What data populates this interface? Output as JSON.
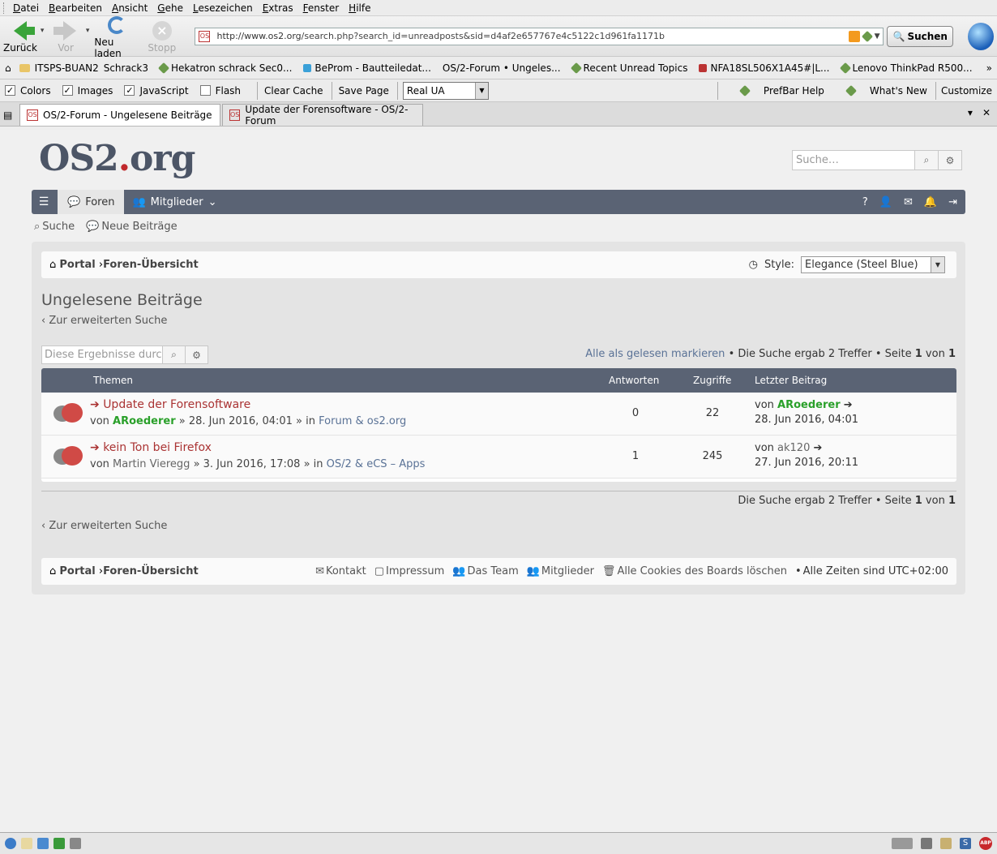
{
  "menu": [
    "Datei",
    "Bearbeiten",
    "Ansicht",
    "Gehe",
    "Lesezeichen",
    "Extras",
    "Fenster",
    "Hilfe"
  ],
  "nav": {
    "back": "Zurück",
    "forward": "Vor",
    "reload": "Neu laden",
    "stop": "Stopp",
    "url_host": "http://www.os2.org",
    "url_path": "/search.php?search_id=unreadposts&sid=d4af2e657767e4c5122c1d961fa1171b",
    "search_button": "Suchen"
  },
  "bookmarks": [
    {
      "label": "ITSPS-BUAN2",
      "icon": "page-icon"
    },
    {
      "label": "Schrack3",
      "icon": ""
    },
    {
      "label": "Hekatron schrack Sec0...",
      "icon": "bookmark-icon"
    },
    {
      "label": "BeProm - Bautteiledat...",
      "icon": "blue-icon"
    },
    {
      "label": "OS/2-Forum • Ungeles...",
      "icon": "os2-icon"
    },
    {
      "label": "Recent Unread Topics",
      "icon": "bookmark-icon"
    },
    {
      "label": "NFA18SL506X1A45#|L...",
      "icon": "m-icon"
    },
    {
      "label": "Lenovo ThinkPad R500...",
      "icon": "bookmark-icon"
    }
  ],
  "prefbar": {
    "checkboxes": [
      {
        "label": "Colors",
        "checked": true
      },
      {
        "label": "Images",
        "checked": true
      },
      {
        "label": "JavaScript",
        "checked": true
      },
      {
        "label": "Flash",
        "checked": false
      }
    ],
    "clear_cache": "Clear Cache",
    "save_page": "Save Page",
    "ua_value": "Real UA",
    "prefbar_help": "PrefBar Help",
    "whats_new": "What's New",
    "customize": "Customize"
  },
  "tabs": [
    {
      "label": "OS/2-Forum - Ungelesene Beiträge",
      "active": true
    },
    {
      "label": "Update der Forensoftware - OS/2-Forum",
      "active": false
    }
  ],
  "site": {
    "logo_main": "OS2",
    "logo_dot": ".",
    "logo_tld": "org",
    "search_placeholder": "Suche…",
    "nav_foren": "Foren",
    "nav_mitglieder": "Mitglieder",
    "sub_suche": "Suche",
    "sub_neue": "Neue Beiträge",
    "crumb_portal": "Portal",
    "crumb_index": "Foren-Übersicht",
    "style_label": "Style:",
    "style_value": "Elegance (Steel Blue)",
    "page_title": "Ungelesene Beiträge",
    "back_link": "Zur erweiterten Suche",
    "results_placeholder": "Diese Ergebnisse durc",
    "mark_read": "Alle als gelesen markieren",
    "bullet": "•",
    "result_text": "Die Suche ergab 2 Treffer",
    "page_label": "Seite",
    "page_current": "1",
    "page_of": "von",
    "page_total": "1"
  },
  "table": {
    "headers": {
      "topics": "Themen",
      "replies": "Antworten",
      "views": "Zugriffe",
      "last": "Letzter Beitrag"
    },
    "rows": [
      {
        "title": "Update der Forensoftware",
        "by": "von",
        "author": "ARoederer",
        "author_style": "green",
        "date": "» 28. Jun 2016, 04:01 » in",
        "forum": "Forum & os2.org",
        "replies": "0",
        "views": "22",
        "last_by": "von",
        "last_author": "ARoederer",
        "last_author_style": "green",
        "last_date": "28. Jun 2016, 04:01"
      },
      {
        "title": "kein Ton bei Firefox",
        "by": "von",
        "author": "Martin Vieregg",
        "author_style": "grey",
        "date": "» 3. Jun 2016, 17:08 » in",
        "forum": "OS/2 & eCS – Apps",
        "replies": "1",
        "views": "245",
        "last_by": "von",
        "last_author": "ak120",
        "last_author_style": "grey",
        "last_date": "27. Jun 2016, 20:11"
      }
    ]
  },
  "footer": {
    "kontakt": "Kontakt",
    "impressum": "Impressum",
    "team": "Das Team",
    "mitglieder": "Mitglieder",
    "cookies": "Alle Cookies des Boards löschen",
    "timezone": "Alle Zeiten sind UTC+02:00"
  }
}
